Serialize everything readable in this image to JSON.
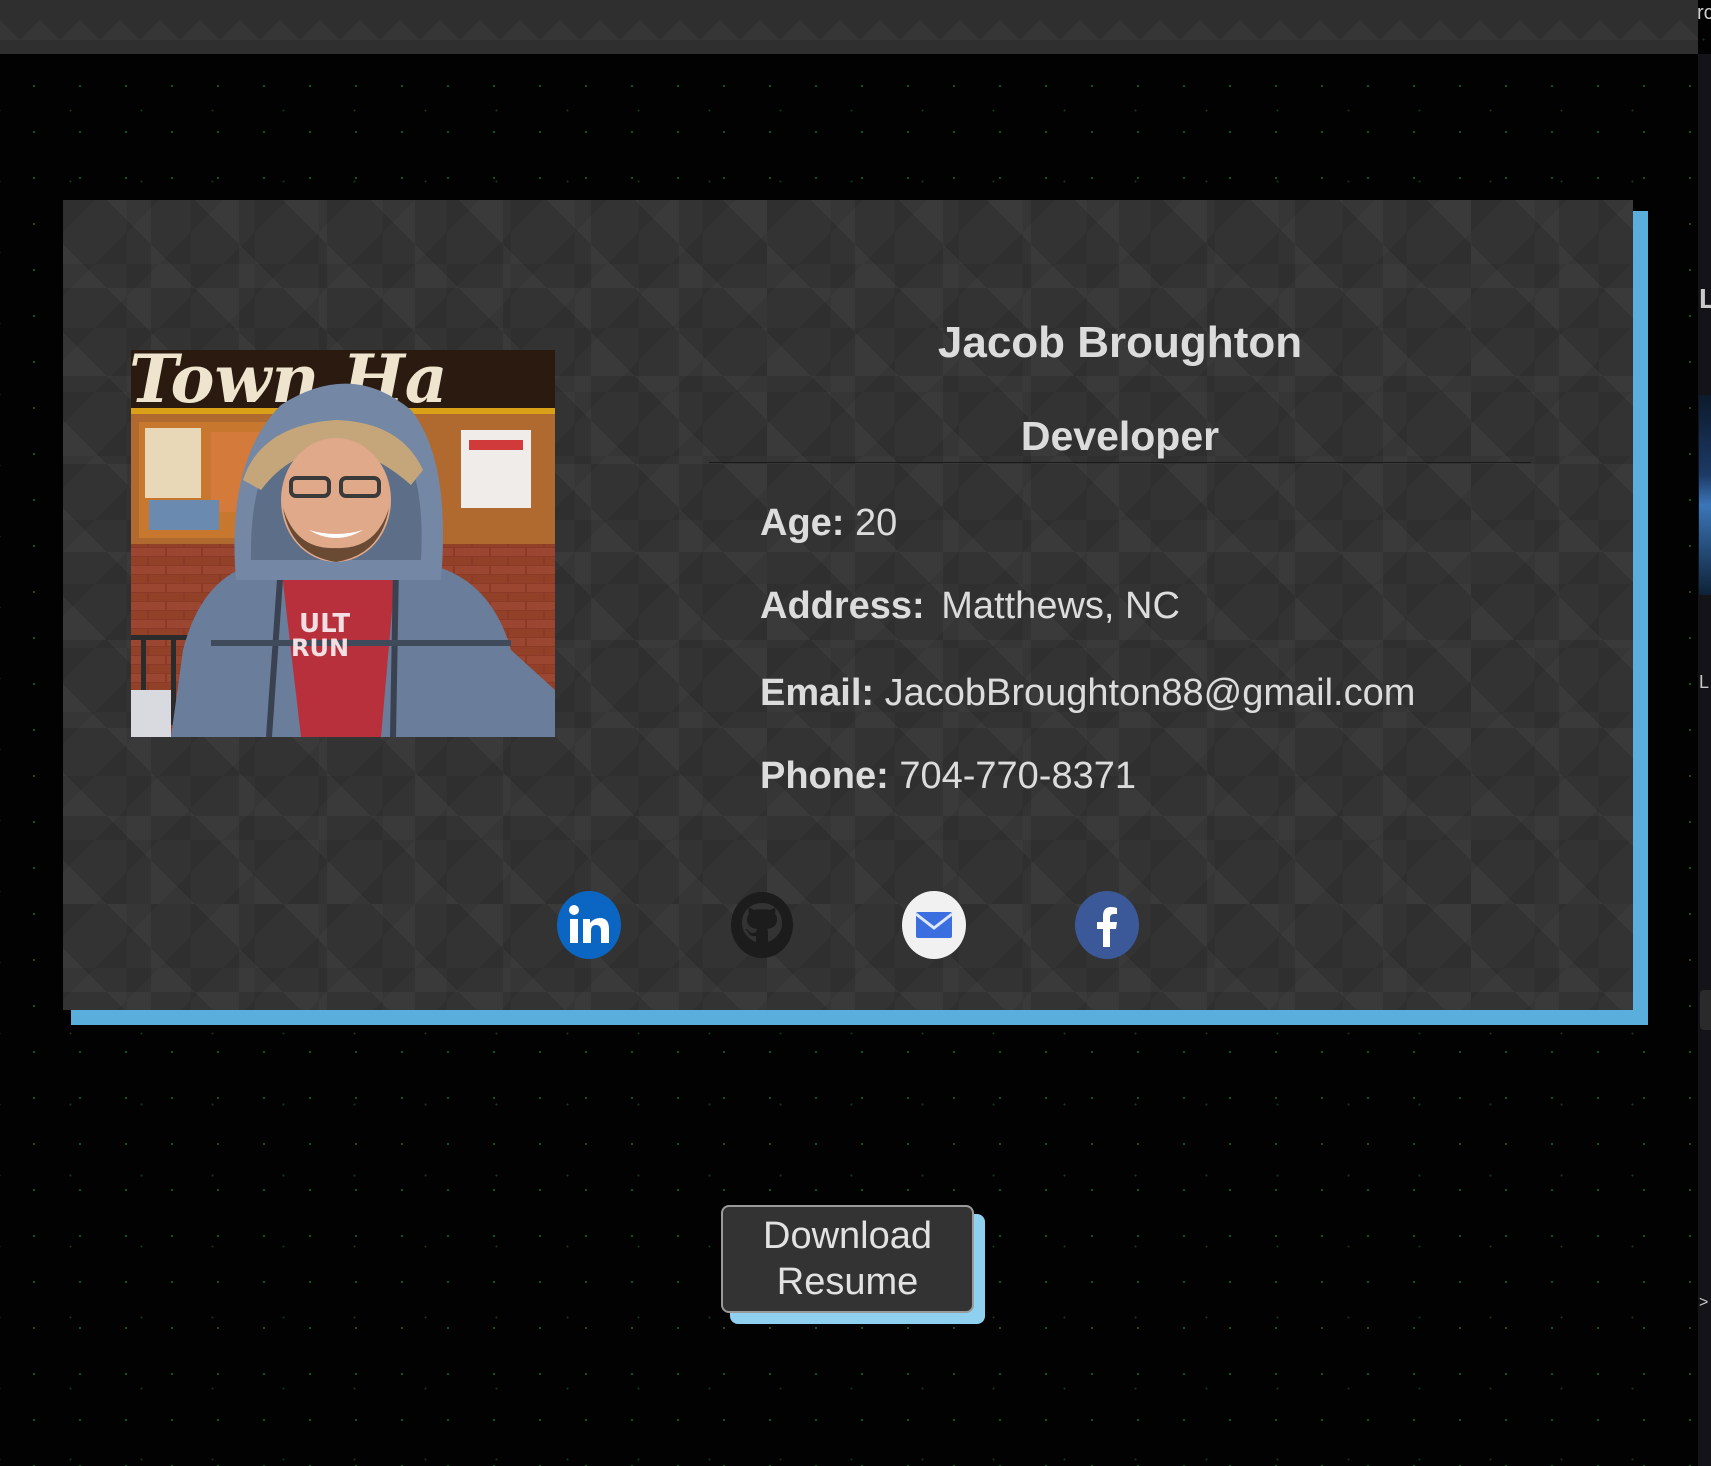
{
  "window": {
    "edge_glyphs": [
      "rc",
      "L",
      "L",
      ">"
    ]
  },
  "profile": {
    "name": "Jacob Broughton",
    "role": "Developer",
    "photo_sign_text": "Town Ha",
    "fields": {
      "age_label": "Age:",
      "age_value": "20",
      "address_label": "Address:",
      "address_value": "Matthews, NC",
      "email_label": "Email:",
      "email_value": "JacobBroughton88@gmail.com",
      "phone_label": "Phone:",
      "phone_value": "704-770-8371"
    }
  },
  "social": [
    {
      "icon": "linkedin-icon",
      "color": "#0a66c2"
    },
    {
      "icon": "github-icon",
      "color": "#222222"
    },
    {
      "icon": "mail-icon",
      "color": "#3b6fe0"
    },
    {
      "icon": "facebook-icon",
      "color": "#3b5998"
    }
  ],
  "actions": {
    "download_line1": "Download",
    "download_line2": "Resume"
  },
  "colors": {
    "card_accent": "#5aaedc",
    "button_accent": "#8fd0ef",
    "card_bg": "#333333",
    "page_bg": "#020202"
  }
}
